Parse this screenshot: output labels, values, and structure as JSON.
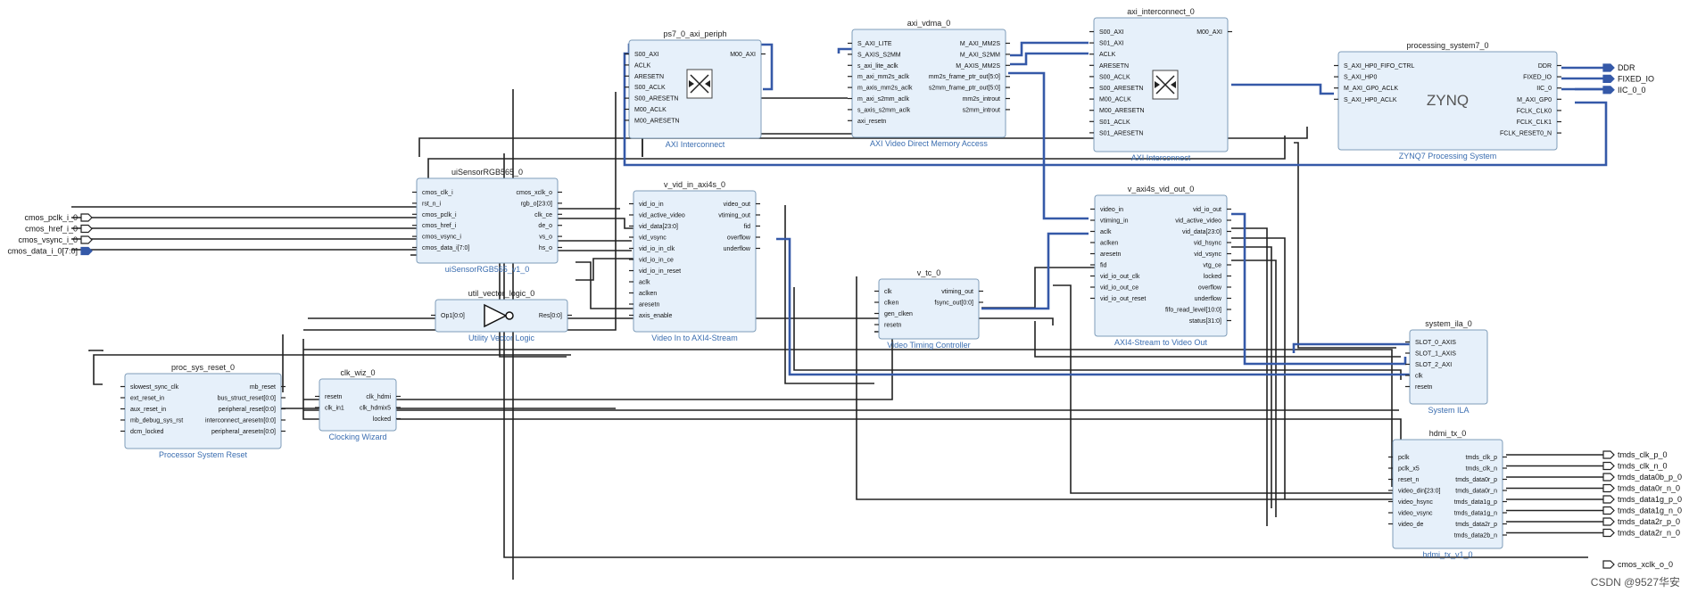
{
  "blocks": [
    {
      "id": "ps7_0_axi_periph",
      "title": "ps7_0_axi_periph",
      "subtitle": "AXI Interconnect",
      "left": [
        "S00_AXI",
        "ACLK",
        "ARESETN",
        "S00_ACLK",
        "S00_ARESETN",
        "M00_ACLK",
        "M00_ARESETN"
      ],
      "right": [
        "M00_AXI"
      ]
    },
    {
      "id": "axi_vdma_0",
      "title": "axi_vdma_0",
      "subtitle": "AXI Video Direct Memory Access",
      "left": [
        "S_AXI_LITE",
        "S_AXIS_S2MM",
        "s_axi_lite_aclk",
        "m_axi_mm2s_aclk",
        "m_axis_mm2s_aclk",
        "m_axi_s2mm_aclk",
        "s_axis_s2mm_aclk",
        "axi_resetn"
      ],
      "right": [
        "M_AXI_MM2S",
        "M_AXI_S2MM",
        "M_AXIS_MM2S",
        "mm2s_frame_ptr_out[5:0]",
        "s2mm_frame_ptr_out[5:0]",
        "mm2s_introut",
        "s2mm_introut"
      ]
    },
    {
      "id": "axi_interconnect_0",
      "title": "axi_interconnect_0",
      "subtitle": "AXI Interconnect",
      "left": [
        "S00_AXI",
        "S01_AXI",
        "ACLK",
        "ARESETN",
        "S00_ACLK",
        "S00_ARESETN",
        "M00_ACLK",
        "M00_ARESETN",
        "S01_ACLK",
        "S01_ARESETN"
      ],
      "right": [
        "M00_AXI"
      ]
    },
    {
      "id": "processing_system7_0",
      "title": "processing_system7_0",
      "subtitle": "ZYNQ7 Processing System",
      "logo": "ZYNQ",
      "left": [
        "S_AXI_HP0_FIFO_CTRL",
        "S_AXI_HP0",
        "M_AXI_GP0_ACLK",
        "S_AXI_HP0_ACLK"
      ],
      "right": [
        "DDR",
        "FIXED_IO",
        "IIC_0",
        "M_AXI_GP0",
        "FCLK_CLK0",
        "FCLK_CLK1",
        "FCLK_RESET0_N"
      ]
    },
    {
      "id": "uiSensorRGB565_0",
      "title": "uiSensorRGB565_0",
      "subtitle": "uiSensorRGB565_v1_0",
      "left": [
        "cmos_clk_i",
        "rst_n_i",
        "cmos_pclk_i",
        "cmos_href_i",
        "cmos_vsync_i",
        "cmos_data_i[7:0]"
      ],
      "right": [
        "cmos_xclk_o",
        "rgb_o[23:0]",
        "clk_ce",
        "de_o",
        "vs_o",
        "hs_o"
      ]
    },
    {
      "id": "util_vector_logic_0",
      "title": "util_vector_logic_0",
      "subtitle": "Utility Vector Logic",
      "left": [
        "Op1[0:0]"
      ],
      "right": [
        "Res[0:0]"
      ]
    },
    {
      "id": "v_vid_in_axi4s_0",
      "title": "v_vid_in_axi4s_0",
      "subtitle": "Video In to AXI4-Stream",
      "left": [
        "vid_io_in",
        "vid_active_video",
        "vid_data[23:0]",
        "vid_vsync",
        "vid_io_in_clk",
        "vid_io_in_ce",
        "vid_io_in_reset",
        "aclk",
        "aclken",
        "aresetn",
        "axis_enable"
      ],
      "right": [
        "video_out",
        "vtiming_out",
        "fid",
        "overflow",
        "underflow"
      ]
    },
    {
      "id": "v_tc_0",
      "title": "v_tc_0",
      "subtitle": "Video Timing Controller",
      "left": [
        "clk",
        "clken",
        "gen_clken",
        "resetn"
      ],
      "right": [
        "vtiming_out",
        "fsync_out[0:0]"
      ]
    },
    {
      "id": "v_axi4s_vid_out_0",
      "title": "v_axi4s_vid_out_0",
      "subtitle": "AXI4-Stream to Video Out",
      "left": [
        "video_in",
        "vtiming_in",
        "aclk",
        "aclken",
        "aresetn",
        "fid",
        "vid_io_out_clk",
        "vid_io_out_ce",
        "vid_io_out_reset"
      ],
      "right": [
        "vid_io_out",
        "vid_active_video",
        "vid_data[23:0]",
        "vid_hsync",
        "vid_vsync",
        "vtg_ce",
        "locked",
        "overflow",
        "underflow",
        "fifo_read_level[10:0]",
        "status[31:0]"
      ]
    },
    {
      "id": "proc_sys_reset_0",
      "title": "proc_sys_reset_0",
      "subtitle": "Processor System Reset",
      "left": [
        "slowest_sync_clk",
        "ext_reset_in",
        "aux_reset_in",
        "mb_debug_sys_rst",
        "dcm_locked"
      ],
      "right": [
        "mb_reset",
        "bus_struct_reset[0:0]",
        "peripheral_reset[0:0]",
        "interconnect_aresetn[0:0]",
        "peripheral_aresetn[0:0]"
      ]
    },
    {
      "id": "clk_wiz_0",
      "title": "clk_wiz_0",
      "subtitle": "Clocking Wizard",
      "left": [
        "resetn",
        "clk_in1"
      ],
      "right": [
        "clk_hdmi",
        "clk_hdmix5",
        "locked"
      ]
    },
    {
      "id": "system_ila_0",
      "title": "system_ila_0",
      "subtitle": "System ILA",
      "left": [
        "SLOT_0_AXIS",
        "SLOT_1_AXIS",
        "SLOT_2_AXI",
        "clk",
        "resetn"
      ],
      "right": []
    },
    {
      "id": "hdmi_tx_0",
      "title": "hdmi_tx_0",
      "subtitle": "hdmi_tx_v1_0",
      "left": [
        "pclk",
        "pclk_x5",
        "reset_n",
        "video_din[23:0]",
        "video_hsync",
        "video_vsync",
        "video_de"
      ],
      "right": [
        "tmds_clk_p",
        "tmds_clk_n",
        "tmds_data0r_p",
        "tmds_data0r_n",
        "tmds_data1g_p",
        "tmds_data1g_n",
        "tmds_data2r_p",
        "tmds_data2b_n"
      ]
    }
  ],
  "ext_inputs": [
    "cmos_pclk_i_0",
    "cmos_href_i_0",
    "cmos_vsync_i_0",
    "cmos_data_i_0[7:0]"
  ],
  "ext_outputs_ps": [
    "DDR",
    "FIXED_IO",
    "IIC_0_0"
  ],
  "ext_outputs_hdmi": [
    "tmds_clk_p_0",
    "tmds_clk_n_0",
    "tmds_data0b_p_0",
    "tmds_data0r_n_0",
    "tmds_data1g_p_0",
    "tmds_data1g_n_0",
    "tmds_data2r_p_0",
    "tmds_data2r_n_0"
  ],
  "ext_output_xclk": "cmos_xclk_o_0",
  "watermark": "CSDN @9527华安",
  "colors": {
    "block_fill": "#e6f0fa",
    "block_border": "#7f9db9",
    "bus": "#3559a8",
    "wire": "#222222"
  }
}
